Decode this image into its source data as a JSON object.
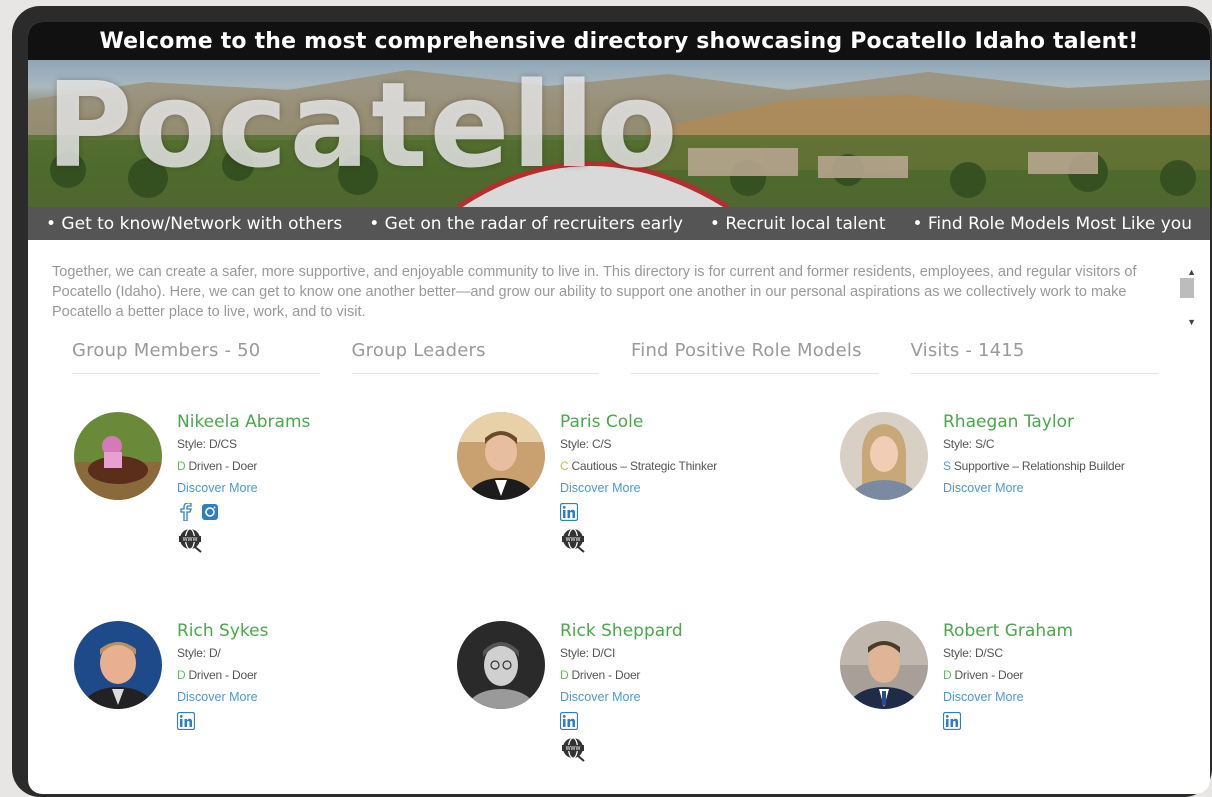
{
  "banner": {
    "welcome": "Welcome to the most comprehensive directory showcasing Pocatello Idaho talent!",
    "hero_title": "Pocatello",
    "taglines": [
      "• Get to know/Network with others",
      "• Get on the radar of recruiters early",
      "• Recruit local talent",
      "• Find Role Models Most Like you"
    ]
  },
  "intro": "Together, we can create a safer, more supportive, and enjoyable community to live in. This directory is for current and former residents, employees, and regular visitors of Pocatello (Idaho). Here, we can get to know one another better—and grow our ability to support one another in our personal aspirations as we collectively work to make Pocatello a better place to live, work, and to visit.",
  "stats": [
    "Group Members - 50",
    "Group Leaders",
    "Find Positive Role Models",
    "Visits - 1415"
  ],
  "members": [
    {
      "name": "Nikeela Abrams",
      "style": "Style: D/CS",
      "trait_letter": "D",
      "trait": "Driven - Doer",
      "link": "Discover More",
      "icons": [
        "facebook-icon",
        "instagram-icon"
      ],
      "globe": true
    },
    {
      "name": "Paris Cole",
      "style": "Style: C/S",
      "trait_letter": "C",
      "trait": "Cautious – Strategic Thinker",
      "link": "Discover More",
      "icons": [
        "linkedin-icon"
      ],
      "globe": true
    },
    {
      "name": "Rhaegan Taylor",
      "style": "Style: S/C",
      "trait_letter": "S",
      "trait": "Supportive – Relationship Builder",
      "link": "Discover More",
      "icons": [],
      "globe": false
    },
    {
      "name": "Rich Sykes",
      "style": "Style: D/",
      "trait_letter": "D",
      "trait": "Driven - Doer",
      "link": "Discover More",
      "icons": [
        "linkedin-icon"
      ],
      "globe": false
    },
    {
      "name": "Rick Sheppard",
      "style": "Style: D/CI",
      "trait_letter": "D",
      "trait": "Driven - Doer",
      "link": "Discover More",
      "icons": [
        "linkedin-icon"
      ],
      "globe": true
    },
    {
      "name": "Robert Graham",
      "style": "Style: D/SC",
      "trait_letter": "D",
      "trait": "Driven - Doer",
      "link": "Discover More",
      "icons": [
        "linkedin-icon"
      ],
      "globe": false
    }
  ],
  "colors": {
    "name_green": "#4aa84a",
    "link_blue": "#4a9ad4",
    "trait_green": "#5cc05c",
    "tag_bar": "#555555"
  }
}
